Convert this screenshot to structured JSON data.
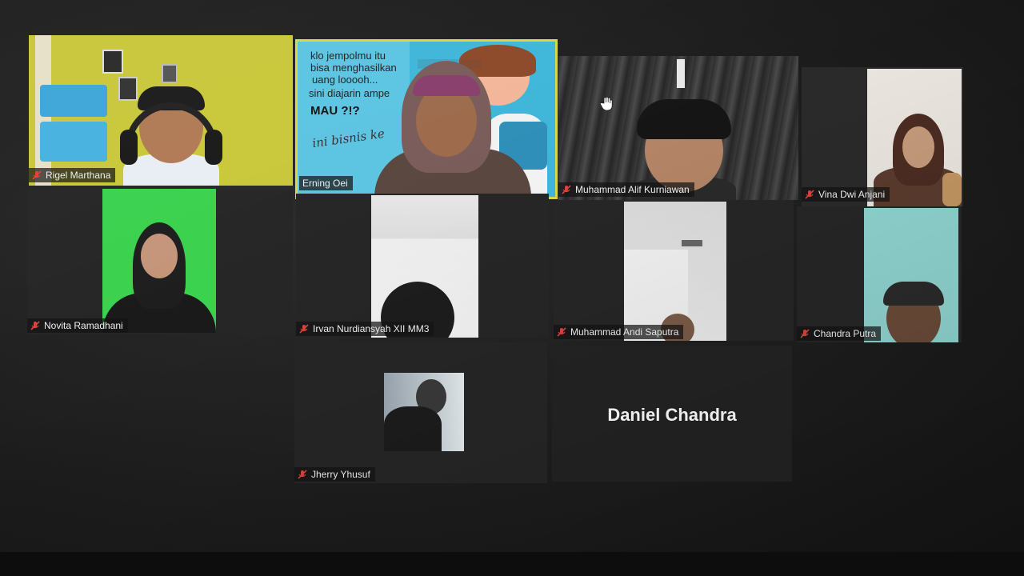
{
  "meeting": {
    "participants": [
      {
        "name": "Rigel Marthana",
        "muted": true
      },
      {
        "name": "Erning Oei",
        "muted": false,
        "active_speaker": true
      },
      {
        "name": "Muhammad Alif Kurniawan",
        "muted": true
      },
      {
        "name": "Vina Dwi Anjani",
        "muted": true
      },
      {
        "name": "Novita Ramadhani",
        "muted": true
      },
      {
        "name": "Irvan Nurdiansyah XII MM3",
        "muted": true
      },
      {
        "name": "Muhammad Andi Saputra",
        "muted": true
      },
      {
        "name": "Chandra Putra",
        "muted": true
      },
      {
        "name": "Jherry Yhusuf",
        "muted": true
      },
      {
        "name": "Daniel Chandra",
        "video_off": true
      }
    ],
    "virtual_background_text": {
      "line1": "klo jempolmu itu",
      "line2": "bisa menghasilkan",
      "line3": "uang looooh...",
      "line4": "sini diajarin ampe",
      "line5": "MAU ?!?",
      "line6": "ini bisnis ke"
    }
  },
  "icons": {
    "muted_mic": "mic-muted-icon",
    "raise_hand": "hand-cursor-icon"
  },
  "colors": {
    "active_speaker_border": "#d8d64a",
    "muted_icon": "#e0413b",
    "tile_background": "#262626"
  }
}
